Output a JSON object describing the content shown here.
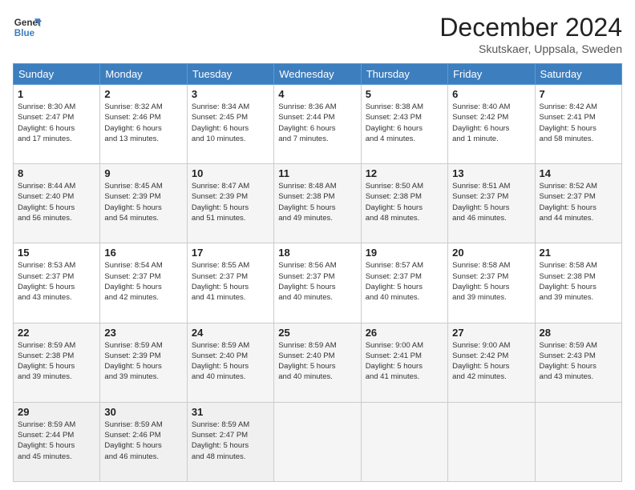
{
  "header": {
    "logo_line1": "General",
    "logo_line2": "Blue",
    "month_title": "December 2024",
    "subtitle": "Skutskaer, Uppsala, Sweden"
  },
  "days_of_week": [
    "Sunday",
    "Monday",
    "Tuesday",
    "Wednesday",
    "Thursday",
    "Friday",
    "Saturday"
  ],
  "weeks": [
    [
      {
        "num": "1",
        "info": "Sunrise: 8:30 AM\nSunset: 2:47 PM\nDaylight: 6 hours\nand 17 minutes."
      },
      {
        "num": "2",
        "info": "Sunrise: 8:32 AM\nSunset: 2:46 PM\nDaylight: 6 hours\nand 13 minutes."
      },
      {
        "num": "3",
        "info": "Sunrise: 8:34 AM\nSunset: 2:45 PM\nDaylight: 6 hours\nand 10 minutes."
      },
      {
        "num": "4",
        "info": "Sunrise: 8:36 AM\nSunset: 2:44 PM\nDaylight: 6 hours\nand 7 minutes."
      },
      {
        "num": "5",
        "info": "Sunrise: 8:38 AM\nSunset: 2:43 PM\nDaylight: 6 hours\nand 4 minutes."
      },
      {
        "num": "6",
        "info": "Sunrise: 8:40 AM\nSunset: 2:42 PM\nDaylight: 6 hours\nand 1 minute."
      },
      {
        "num": "7",
        "info": "Sunrise: 8:42 AM\nSunset: 2:41 PM\nDaylight: 5 hours\nand 58 minutes."
      }
    ],
    [
      {
        "num": "8",
        "info": "Sunrise: 8:44 AM\nSunset: 2:40 PM\nDaylight: 5 hours\nand 56 minutes."
      },
      {
        "num": "9",
        "info": "Sunrise: 8:45 AM\nSunset: 2:39 PM\nDaylight: 5 hours\nand 54 minutes."
      },
      {
        "num": "10",
        "info": "Sunrise: 8:47 AM\nSunset: 2:39 PM\nDaylight: 5 hours\nand 51 minutes."
      },
      {
        "num": "11",
        "info": "Sunrise: 8:48 AM\nSunset: 2:38 PM\nDaylight: 5 hours\nand 49 minutes."
      },
      {
        "num": "12",
        "info": "Sunrise: 8:50 AM\nSunset: 2:38 PM\nDaylight: 5 hours\nand 48 minutes."
      },
      {
        "num": "13",
        "info": "Sunrise: 8:51 AM\nSunset: 2:37 PM\nDaylight: 5 hours\nand 46 minutes."
      },
      {
        "num": "14",
        "info": "Sunrise: 8:52 AM\nSunset: 2:37 PM\nDaylight: 5 hours\nand 44 minutes."
      }
    ],
    [
      {
        "num": "15",
        "info": "Sunrise: 8:53 AM\nSunset: 2:37 PM\nDaylight: 5 hours\nand 43 minutes."
      },
      {
        "num": "16",
        "info": "Sunrise: 8:54 AM\nSunset: 2:37 PM\nDaylight: 5 hours\nand 42 minutes."
      },
      {
        "num": "17",
        "info": "Sunrise: 8:55 AM\nSunset: 2:37 PM\nDaylight: 5 hours\nand 41 minutes."
      },
      {
        "num": "18",
        "info": "Sunrise: 8:56 AM\nSunset: 2:37 PM\nDaylight: 5 hours\nand 40 minutes."
      },
      {
        "num": "19",
        "info": "Sunrise: 8:57 AM\nSunset: 2:37 PM\nDaylight: 5 hours\nand 40 minutes."
      },
      {
        "num": "20",
        "info": "Sunrise: 8:58 AM\nSunset: 2:37 PM\nDaylight: 5 hours\nand 39 minutes."
      },
      {
        "num": "21",
        "info": "Sunrise: 8:58 AM\nSunset: 2:38 PM\nDaylight: 5 hours\nand 39 minutes."
      }
    ],
    [
      {
        "num": "22",
        "info": "Sunrise: 8:59 AM\nSunset: 2:38 PM\nDaylight: 5 hours\nand 39 minutes."
      },
      {
        "num": "23",
        "info": "Sunrise: 8:59 AM\nSunset: 2:39 PM\nDaylight: 5 hours\nand 39 minutes."
      },
      {
        "num": "24",
        "info": "Sunrise: 8:59 AM\nSunset: 2:40 PM\nDaylight: 5 hours\nand 40 minutes."
      },
      {
        "num": "25",
        "info": "Sunrise: 8:59 AM\nSunset: 2:40 PM\nDaylight: 5 hours\nand 40 minutes."
      },
      {
        "num": "26",
        "info": "Sunrise: 9:00 AM\nSunset: 2:41 PM\nDaylight: 5 hours\nand 41 minutes."
      },
      {
        "num": "27",
        "info": "Sunrise: 9:00 AM\nSunset: 2:42 PM\nDaylight: 5 hours\nand 42 minutes."
      },
      {
        "num": "28",
        "info": "Sunrise: 8:59 AM\nSunset: 2:43 PM\nDaylight: 5 hours\nand 43 minutes."
      }
    ],
    [
      {
        "num": "29",
        "info": "Sunrise: 8:59 AM\nSunset: 2:44 PM\nDaylight: 5 hours\nand 45 minutes."
      },
      {
        "num": "30",
        "info": "Sunrise: 8:59 AM\nSunset: 2:46 PM\nDaylight: 5 hours\nand 46 minutes."
      },
      {
        "num": "31",
        "info": "Sunrise: 8:59 AM\nSunset: 2:47 PM\nDaylight: 5 hours\nand 48 minutes."
      },
      {
        "num": "",
        "info": ""
      },
      {
        "num": "",
        "info": ""
      },
      {
        "num": "",
        "info": ""
      },
      {
        "num": "",
        "info": ""
      }
    ]
  ]
}
